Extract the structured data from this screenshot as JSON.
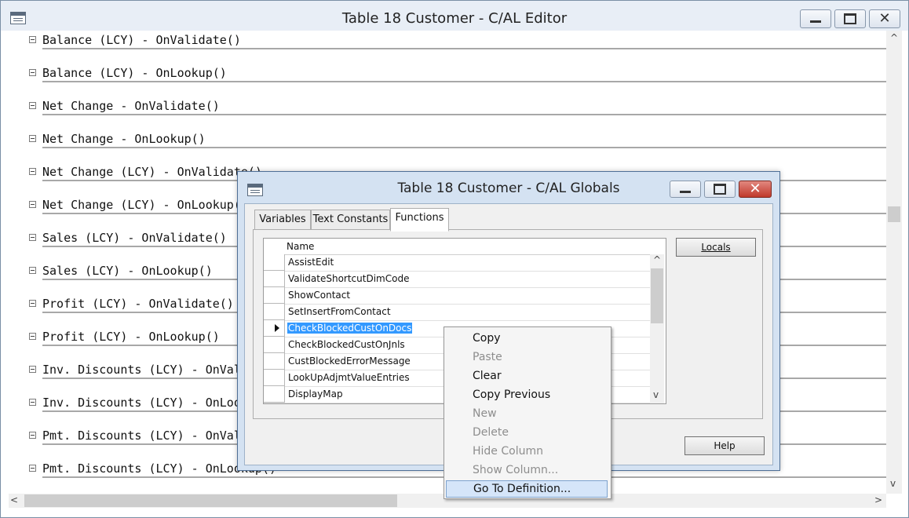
{
  "editor": {
    "title": "Table 18 Customer - C/AL Editor",
    "triggers": [
      "Balance (LCY) - OnValidate()",
      "Balance (LCY) - OnLookup()",
      "Net Change - OnValidate()",
      "Net Change - OnLookup()",
      "Net Change (LCY) - OnValidate()",
      "Net Change (LCY) - OnLookup()",
      "Sales (LCY) - OnValidate()",
      "Sales (LCY) - OnLookup()",
      "Profit (LCY) - OnValidate()",
      "Profit (LCY) - OnLookup()",
      "Inv. Discounts (LCY) - OnValidate()",
      "Inv. Discounts (LCY) - OnLookup()",
      "Pmt. Discounts (LCY) - OnValidate()",
      "Pmt. Discounts (LCY) - OnLookup()"
    ],
    "scroll_up": "^",
    "scroll_down": "v",
    "scroll_left": "<",
    "scroll_right": ">"
  },
  "globals": {
    "title": "Table 18 Customer - C/AL Globals",
    "tabs": [
      "Variables",
      "Text Constants",
      "Functions"
    ],
    "active_tab": "Functions",
    "grid": {
      "column_header": "Name",
      "rows": [
        "AssistEdit",
        "ValidateShortcutDimCode",
        "ShowContact",
        "SetInsertFromContact",
        "CheckBlockedCustOnDocs",
        "CheckBlockedCustOnJnls",
        "CustBlockedErrorMessage",
        "LookUpAdjmtValueEntries",
        "DisplayMap"
      ],
      "selected_row": "CheckBlockedCustOnDocs"
    },
    "locals_button": "Locals",
    "help_button": "Help"
  },
  "context_menu": {
    "items": [
      {
        "label": "Copy",
        "enabled": true
      },
      {
        "label": "Paste",
        "enabled": false
      },
      {
        "label": "Clear",
        "enabled": true
      },
      {
        "label": "Copy Previous",
        "enabled": true
      },
      {
        "label": "New",
        "enabled": false
      },
      {
        "label": "Delete",
        "enabled": false
      },
      {
        "label": "Hide Column",
        "enabled": false
      },
      {
        "label": "Show Column...",
        "enabled": false
      },
      {
        "label": "Go To Definition...",
        "enabled": true
      }
    ],
    "hovered": "Go To Definition..."
  },
  "colors": {
    "selection": "#3399ff",
    "menu_hover": "#d5e5f9",
    "close_button": "#d0413a",
    "dialog_frame": "#d4e2f2"
  }
}
